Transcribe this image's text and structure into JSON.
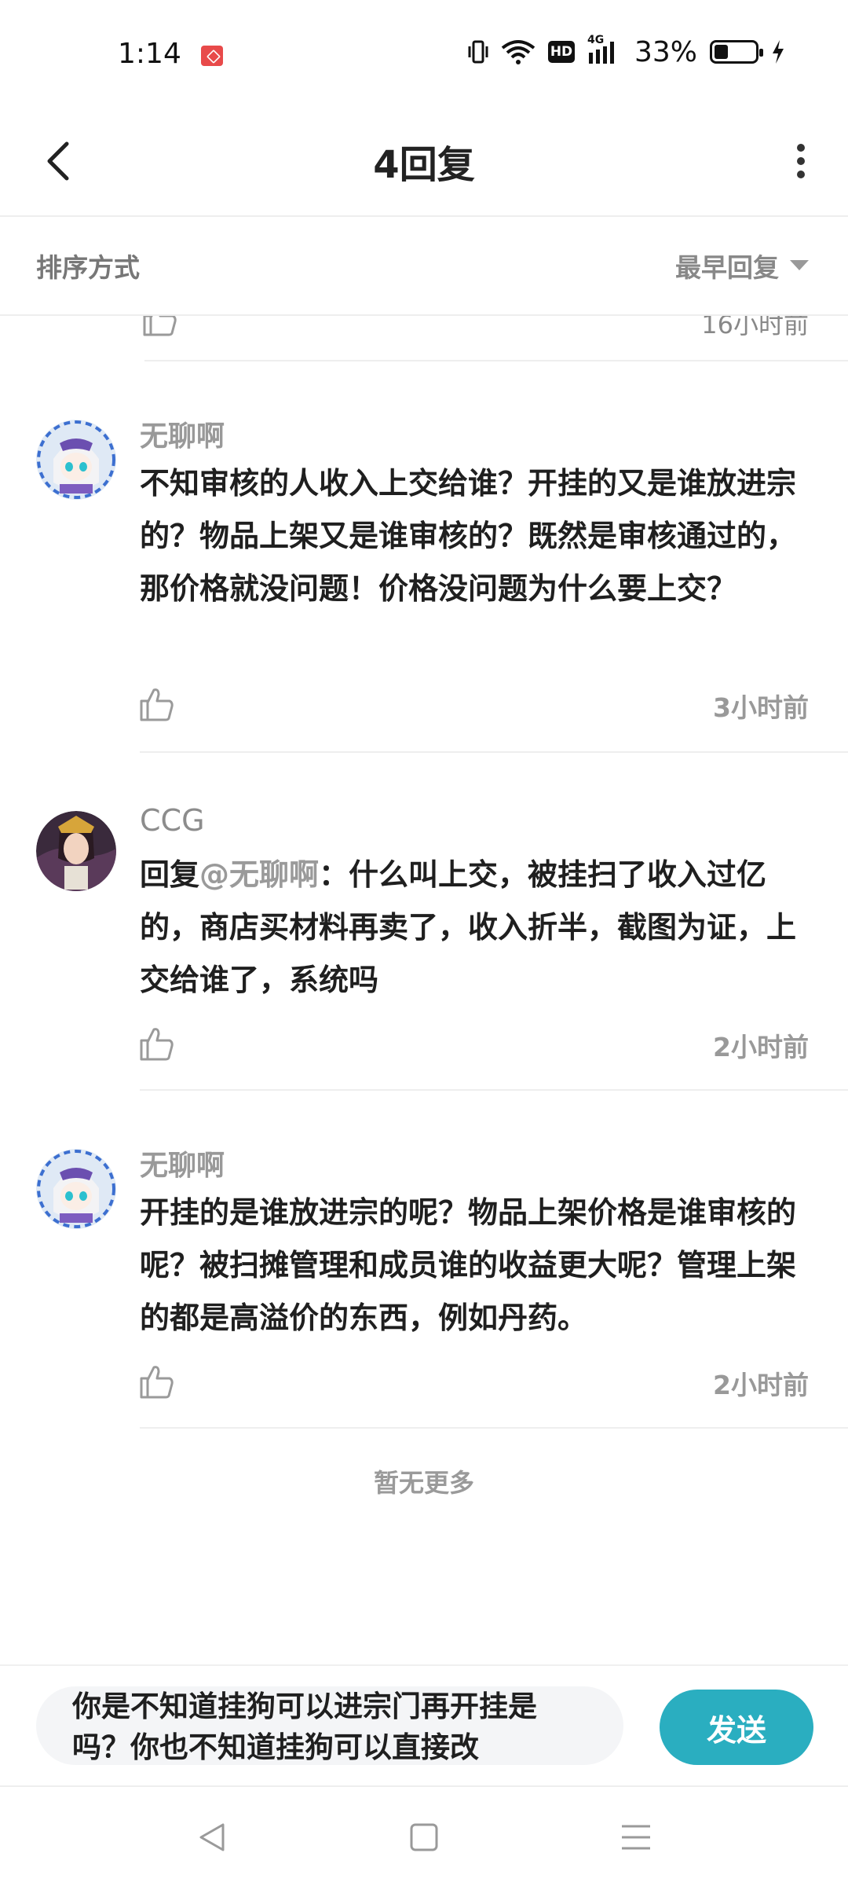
{
  "status_bar": {
    "time": "1:14",
    "network_label": "4G",
    "hd_label": "HD",
    "battery_percent": "33%",
    "battery_level": 0.33,
    "icons": [
      "app-notification-icon",
      "vibrate-icon",
      "wifi-icon",
      "hd-icon",
      "signal-icon",
      "battery-icon",
      "charging-icon"
    ]
  },
  "header": {
    "title": "4回复",
    "back_icon": "back-arrow-icon",
    "more_icon": "more-vertical-icon"
  },
  "sort": {
    "label": "排序方式",
    "value": "最早回复"
  },
  "partial_row": {
    "time": "16小时前"
  },
  "comments": [
    {
      "name": "无聊啊",
      "text": "不知审核的人收入上交给谁？开挂的又是谁放进宗的？物品上架又是谁审核的？既然是审核通过的，那价格就没问题！价格没问题为什么要上交？",
      "time": "3小时前"
    },
    {
      "name": "CCG",
      "reply_prefix": "回复",
      "mention": "@无聊啊",
      "text": "：什么叫上交，被挂扫了收入过亿的，商店买材料再卖了，收入折半，截图为证，上交给谁了，系统吗",
      "time": "2小时前"
    },
    {
      "name": "无聊啊",
      "text": "开挂的是谁放进宗的呢？物品上架价格是谁审核的呢？被扫摊管理和成员谁的收益更大呢？管理上架的都是高溢价的东西，例如丹药。",
      "time": "2小时前"
    }
  ],
  "no_more": "暂无更多",
  "input": {
    "value": "你是不知道挂狗可以进宗门再开挂是吗？你也不知道挂狗可以直接改"
  },
  "send_button": "发送",
  "colors": {
    "accent": "#2aaec0",
    "muted_text": "#999999",
    "body_text": "#1f1f1f"
  }
}
